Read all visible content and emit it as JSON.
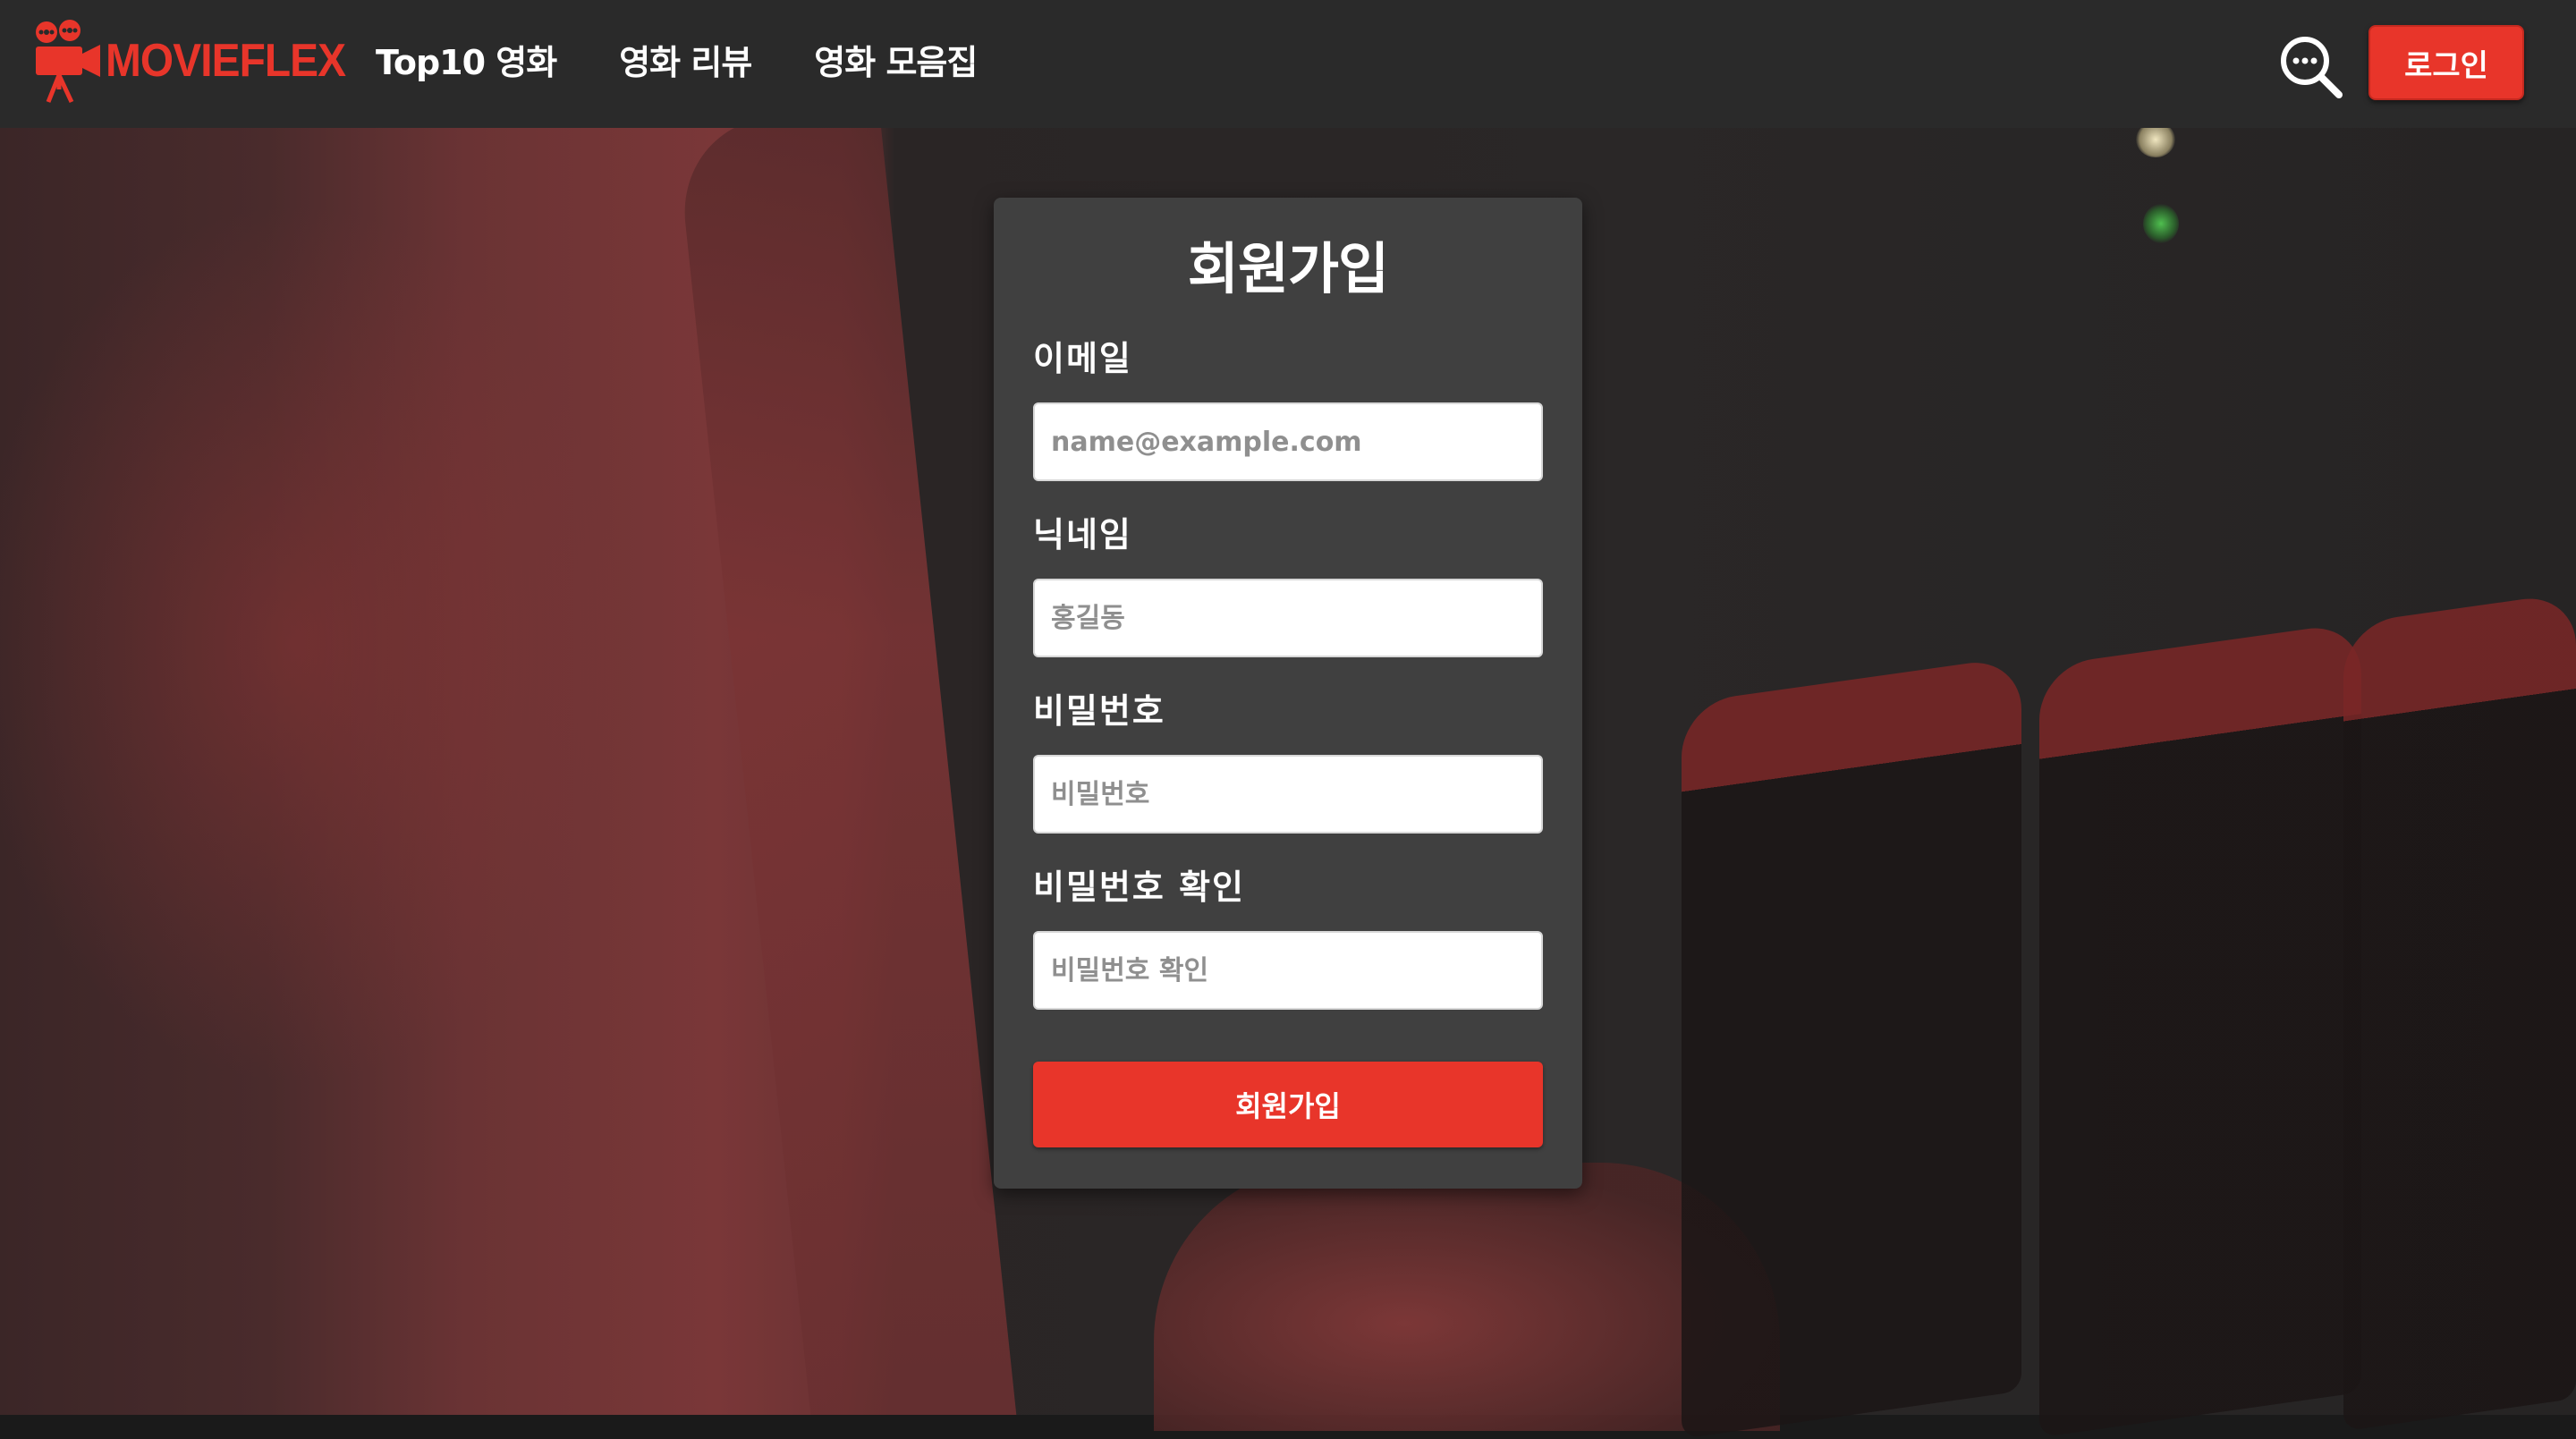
{
  "brand": {
    "name": "MOVIEFLEX",
    "color": "#e8352a"
  },
  "nav": {
    "items": [
      {
        "label": "Top10 영화"
      },
      {
        "label": "영화 리뷰"
      },
      {
        "label": "영화 모음집"
      }
    ]
  },
  "header": {
    "search_icon": "search-icon",
    "login_label": "로그인"
  },
  "signup": {
    "title": "회원가입",
    "fields": [
      {
        "label": "이메일",
        "placeholder": "name@example.com",
        "type": "email"
      },
      {
        "label": "닉네임",
        "placeholder": "홍길동",
        "type": "text"
      },
      {
        "label": "비밀번호",
        "placeholder": "비밀번호",
        "type": "password"
      },
      {
        "label": "비밀번호 확인",
        "placeholder": "비밀번호 확인",
        "type": "password"
      }
    ],
    "submit_label": "회원가입"
  },
  "colors": {
    "accent": "#e8352a",
    "header_bg": "#2a2a2a",
    "card_bg": "#404040"
  }
}
